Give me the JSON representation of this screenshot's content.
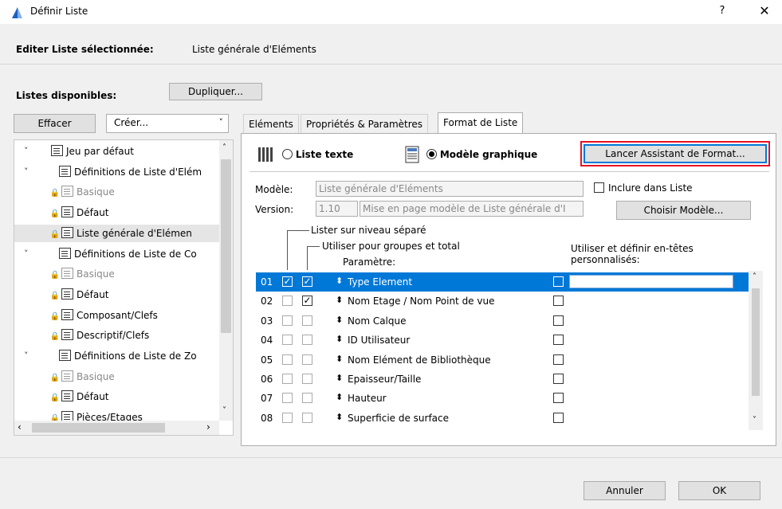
{
  "window": {
    "title": "Définir Liste",
    "help_label": "?",
    "close_label": "✕"
  },
  "edit": {
    "label": "Editer Liste sélectionnée:",
    "value": "Liste générale d'Eléments"
  },
  "available": {
    "label": "Listes disponibles:",
    "duplicate_button": "Dupliquer...",
    "delete_button": "Effacer",
    "create_combo": "Créer..."
  },
  "tree": {
    "items": [
      {
        "label": "Jeu par défaut",
        "level": 0,
        "chevron": "˅",
        "icon": "document-icon"
      },
      {
        "label": "Définitions de Liste d'Elém",
        "level": 1,
        "chevron": "˅",
        "icon": "element-list-icon"
      },
      {
        "label": "Basique",
        "level": 2,
        "locked": true,
        "dim": true
      },
      {
        "label": "Défaut",
        "level": 2,
        "locked": true
      },
      {
        "label": "Liste générale d'Elémen",
        "level": 2,
        "locked": true,
        "selected": true
      },
      {
        "label": "Définitions de Liste de Co",
        "level": 1,
        "chevron": "˅",
        "icon": "component-list-icon"
      },
      {
        "label": "Basique",
        "level": 2,
        "locked": true,
        "dim": true
      },
      {
        "label": "Défaut",
        "level": 2,
        "locked": true
      },
      {
        "label": "Composant/Clefs",
        "level": 2,
        "locked": true
      },
      {
        "label": "Descriptif/Clefs",
        "level": 2,
        "locked": true
      },
      {
        "label": "Définitions de Liste de Zo",
        "level": 1,
        "chevron": "˅",
        "icon": "zone-list-icon"
      },
      {
        "label": "Basique",
        "level": 2,
        "locked": true,
        "dim": true
      },
      {
        "label": "Défaut",
        "level": 2,
        "locked": true
      },
      {
        "label": "Pièces/Etages",
        "level": 2,
        "locked": true
      }
    ]
  },
  "tabs": [
    {
      "label": "Eléments",
      "active": false
    },
    {
      "label": "Propriétés & Paramètres",
      "active": false
    },
    {
      "label": "Format de Liste",
      "active": true
    }
  ],
  "format": {
    "text_list_label": "Liste texte",
    "graphic_model_label": "Modèle graphique",
    "graphic_model_selected": true,
    "wizard_button": "Lancer Assistant de Format...",
    "model_label": "Modèle:",
    "model_value": "Liste générale d'Eléments",
    "version_label": "Version:",
    "version_number": "1.10",
    "version_desc": "Mise en page modèle de Liste générale d'I",
    "include_label": "Inclure dans Liste",
    "choose_model_button": "Choisir Modèle...",
    "col_separate_level": "Lister sur niveau séparé",
    "col_groups_total": "Utiliser pour groupes et total",
    "col_parameter": "Paramètre:",
    "col_custom_headers_1": "Utiliser et définir en-têtes",
    "col_custom_headers_2": "personnalisés:"
  },
  "rows": [
    {
      "num": "01",
      "sep": true,
      "grp": true,
      "name": "Type Element",
      "custom": false,
      "selected": true
    },
    {
      "num": "02",
      "sep": false,
      "grp": true,
      "name": "Nom Etage / Nom Point de vue",
      "custom": false
    },
    {
      "num": "03",
      "sep": false,
      "grp": false,
      "name": "Nom Calque",
      "custom": false
    },
    {
      "num": "04",
      "sep": false,
      "grp": false,
      "name": "ID Utilisateur",
      "custom": false
    },
    {
      "num": "05",
      "sep": false,
      "grp": false,
      "name": "Nom Elément de Bibliothèque",
      "custom": false
    },
    {
      "num": "06",
      "sep": false,
      "grp": false,
      "name": "Epaisseur/Taille",
      "custom": false
    },
    {
      "num": "07",
      "sep": false,
      "grp": false,
      "name": "Hauteur",
      "custom": false
    },
    {
      "num": "08",
      "sep": false,
      "grp": false,
      "name": "Superficie de surface",
      "custom": false
    }
  ],
  "footer": {
    "cancel_button": "Annuler",
    "ok_button": "OK"
  },
  "colors": {
    "selection": "#0078d7",
    "highlight_outline": "#e81123"
  }
}
